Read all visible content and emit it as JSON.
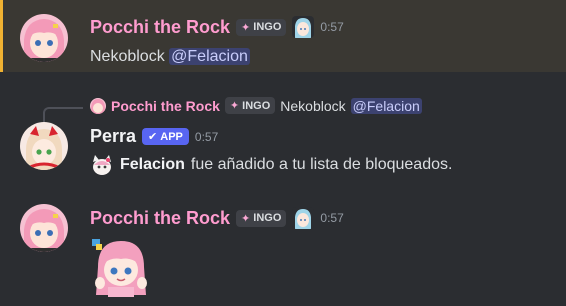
{
  "messages": [
    {
      "username": "Pocchi the Rock",
      "tag": "INGO",
      "time": "0:57",
      "content_text": "Nekoblock",
      "mention": "@Felacion"
    },
    {
      "reply": {
        "username": "Pocchi the Rock",
        "tag": "INGO",
        "text": "Nekoblock",
        "mention": "@Felacion"
      },
      "username": "Perra",
      "app_tag": "APP",
      "time": "0:57",
      "content_bold": "Felacion",
      "content_text": "fue añadido a tu lista de bloqueados."
    },
    {
      "username": "Pocchi the Rock",
      "tag": "INGO",
      "time": "0:57"
    }
  ],
  "colors": {
    "background": "#2b2d31",
    "highlight": "#3a3833",
    "highlight_bar": "#f0b232",
    "username_pink": "#ff9ccf",
    "mention_bg": "#3c4270",
    "app_badge": "#5865f2"
  }
}
